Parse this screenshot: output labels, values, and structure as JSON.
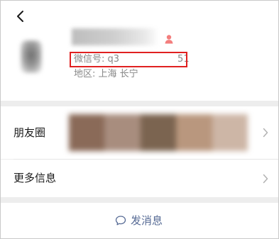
{
  "profile": {
    "wechat_id_label": "微信号: q3",
    "wechat_id_suffix": "51",
    "region": "地区: 上海 长宁"
  },
  "rows": {
    "moments_label": "朋友圈",
    "more_info_label": "更多信息"
  },
  "actions": {
    "send_message_label": "发消息"
  },
  "icons": {
    "back": "back-arrow-icon",
    "gender": "female-person-icon",
    "chevron": "chevron-right-icon",
    "chat": "chat-bubble-icon"
  },
  "colors": {
    "highlight_box": "#e02020",
    "link": "#576b95",
    "gender_icon": "#f37e7d"
  }
}
